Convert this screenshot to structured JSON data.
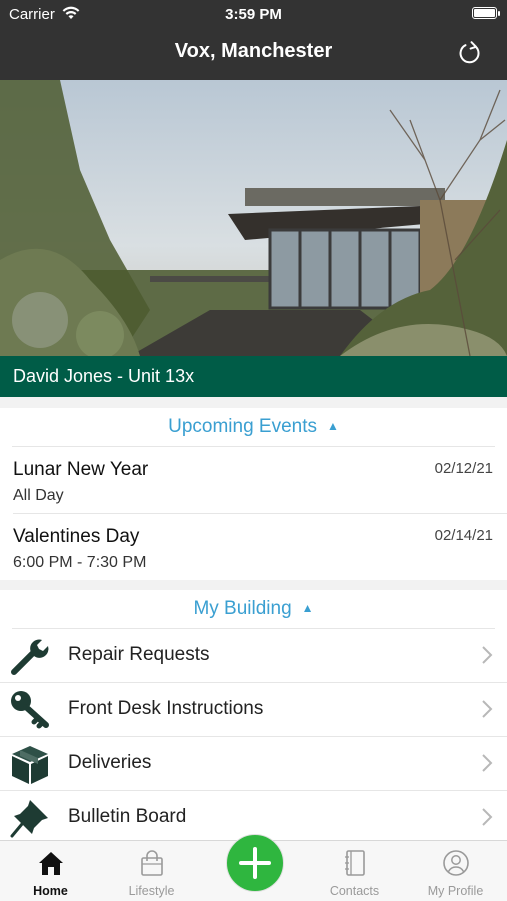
{
  "status_bar": {
    "carrier": "Carrier",
    "time": "3:59 PM"
  },
  "nav": {
    "title": "Vox, Manchester"
  },
  "unit": {
    "label": "David Jones - Unit 13x"
  },
  "events": {
    "header": "Upcoming Events",
    "items": [
      {
        "name": "Lunar New Year",
        "sub": "All Day",
        "date": "02/12/21"
      },
      {
        "name": "Valentines Day",
        "sub": "6:00 PM - 7:30 PM",
        "date": "02/14/21"
      }
    ]
  },
  "building": {
    "header": "My Building",
    "items": [
      {
        "label": "Repair Requests",
        "icon": "wrench-icon"
      },
      {
        "label": "Front Desk Instructions",
        "icon": "key-icon"
      },
      {
        "label": "Deliveries",
        "icon": "package-icon"
      },
      {
        "label": "Bulletin Board",
        "icon": "pushpin-icon"
      }
    ]
  },
  "tabs": [
    {
      "label": "Home",
      "icon": "home-icon",
      "active": true
    },
    {
      "label": "Lifestyle",
      "icon": "shopping-bag-icon",
      "active": false
    },
    {
      "label": "Contacts",
      "icon": "address-book-icon",
      "active": false
    },
    {
      "label": "My Profile",
      "icon": "profile-icon",
      "active": false
    }
  ],
  "colors": {
    "header_bg": "#333333",
    "accent_green": "#005c47",
    "link_blue": "#3a9fd1",
    "add_button": "#2fb63f"
  }
}
